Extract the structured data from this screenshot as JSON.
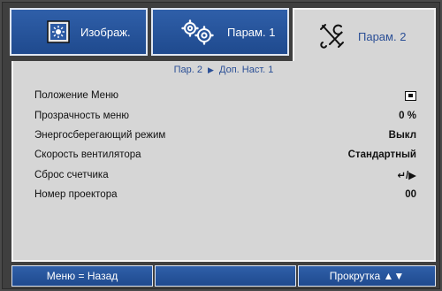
{
  "tabs": [
    {
      "label": "Изображ.",
      "icon": "image-icon"
    },
    {
      "label": "Парам. 1",
      "icon": "gears-icon"
    },
    {
      "label": "Парам. 2",
      "icon": "tools-icon"
    }
  ],
  "breadcrumb": {
    "part1": "Пар. 2",
    "separator": "▶",
    "part2": "Доп. Наст. 1"
  },
  "rows": [
    {
      "label": "Положение Меню",
      "value": "",
      "value_icon": "menu-position-icon"
    },
    {
      "label": "Прозрачность меню",
      "value": "0 %"
    },
    {
      "label": "Энергосберегающий режим",
      "value": "Выкл"
    },
    {
      "label": "Скорость вентилятора",
      "value": "Стандартный"
    },
    {
      "label": "Сброс счетчика",
      "value": "↵/▶"
    },
    {
      "label": "Номер проектора",
      "value": "00"
    }
  ],
  "footer": {
    "back": "Меню = Назад",
    "middle": "",
    "scroll": "Прокрутка ▲▼"
  },
  "colors": {
    "tab_blue": "#2f5fa9",
    "panel_gray": "#d6d6d6",
    "accent_text": "#2b4f96"
  }
}
